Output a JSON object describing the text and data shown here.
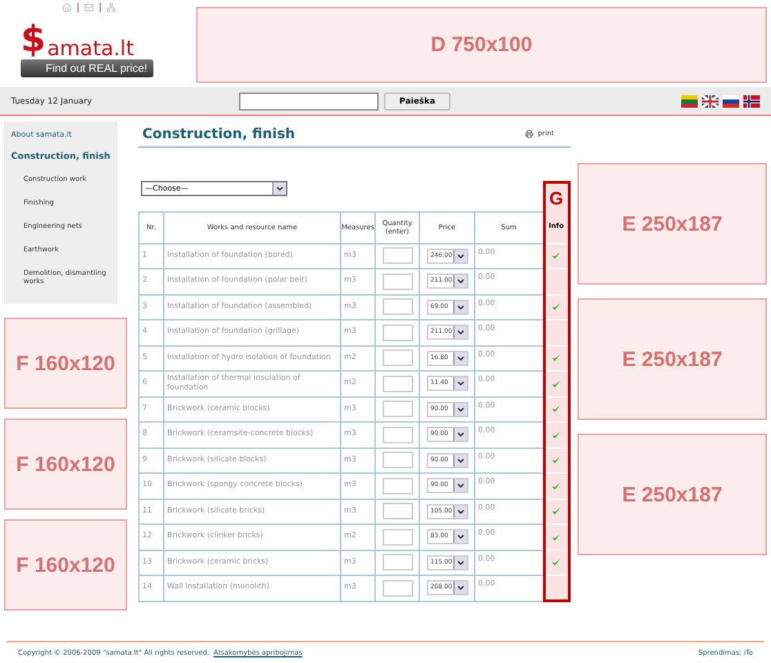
{
  "header": {
    "logo": {
      "mark": "$",
      "name": "amata.lt",
      "tagline": "Find out REAL price!"
    },
    "banner": {
      "letter": "D",
      "size": "750x100"
    }
  },
  "top_bar": {
    "date": "Tuesday 12 January",
    "search_button": "Paieška"
  },
  "sidebar": {
    "items": [
      {
        "label": "About samata.lt",
        "selected": false
      },
      {
        "label": "Construction, finish",
        "selected": true,
        "children": [
          {
            "label": "Construction work",
            "selected": false
          },
          {
            "label": "Finishing",
            "selected": false
          },
          {
            "label": "Engineering nets",
            "selected": false
          },
          {
            "label": "Earthwork",
            "selected": false
          },
          {
            "label": "Demolition, dismantling works",
            "selected": false
          }
        ]
      }
    ]
  },
  "left_ads": [
    {
      "letter": "F",
      "size": "160x120"
    },
    {
      "letter": "F",
      "size": "160x120"
    },
    {
      "letter": "F",
      "size": "160x120"
    }
  ],
  "right_ads": [
    {
      "letter": "E",
      "size": "250x187"
    },
    {
      "letter": "E",
      "size": "250x187"
    },
    {
      "letter": "E",
      "size": "250x187"
    }
  ],
  "main": {
    "title": "Construction, finish",
    "print": "print",
    "select": "—Choose—",
    "info_ad": "G",
    "columns": [
      "Nr.",
      "Works and resource name",
      "Measures",
      "Quantity (enter)",
      "Price",
      "Sum",
      "Info"
    ],
    "rows": [
      {
        "nr": "1",
        "name": "Installation of foundation (bored)",
        "unit": "m3",
        "price": "246.00",
        "sum": "0.00",
        "info": true
      },
      {
        "nr": "2",
        "name": "Installation of foundation (polar belt)",
        "unit": "m3",
        "price": "211.00",
        "sum": "0.00",
        "info": false
      },
      {
        "nr": "3",
        "name": "Installation of foundation (assembled)",
        "unit": "m3",
        "price": "69.00",
        "sum": "0.00",
        "info": true
      },
      {
        "nr": "4",
        "name": "Installation of foundation (grillage)",
        "unit": "m3",
        "price": "211.00",
        "sum": "0.00",
        "info": false
      },
      {
        "nr": "5",
        "name": "Installation of hydro isolation of foundation",
        "unit": "m2",
        "price": "16.80",
        "sum": "0.00",
        "info": true
      },
      {
        "nr": "6",
        "name": "Installation of thermal insulation of foundation",
        "unit": "m2",
        "price": "11.40",
        "sum": "0.00",
        "info": true
      },
      {
        "nr": "7",
        "name": "Brickwork (ceramic blocks)",
        "unit": "m3",
        "price": "90.00",
        "sum": "0.00",
        "info": true
      },
      {
        "nr": "8",
        "name": "Brickwork (ceramsite-concrete blocks)",
        "unit": "m3",
        "price": "90.00",
        "sum": "0.00",
        "info": true
      },
      {
        "nr": "9",
        "name": "Brickwork (silicate blocks)",
        "unit": "m3",
        "price": "90.00",
        "sum": "0.00",
        "info": true
      },
      {
        "nr": "10",
        "name": "Brickwork (spongy concrete blocks)",
        "unit": "m3",
        "price": "90.00",
        "sum": "0.00",
        "info": true
      },
      {
        "nr": "11",
        "name": "Brickwork (silicate bricks)",
        "unit": "m3",
        "price": "105.00",
        "sum": "0.00",
        "info": true
      },
      {
        "nr": "12",
        "name": "Brickwork (clinker bricks)",
        "unit": "m2",
        "price": "83.00",
        "sum": "0.00",
        "info": true
      },
      {
        "nr": "13",
        "name": "Brickwork (ceramic bricks)",
        "unit": "m3",
        "price": "115.00",
        "sum": "0.00",
        "info": true
      },
      {
        "nr": "14",
        "name": "Wall installation (monolith)",
        "unit": "m3",
        "price": "268.00",
        "sum": "0.00",
        "info": false
      }
    ]
  },
  "footer": {
    "copyright": "Copyright © 2006-2009 \"samata.lt\" All rights reserved.",
    "link": "Atsakomybės apribojimas",
    "credit": "Sprendimas: iTo"
  }
}
